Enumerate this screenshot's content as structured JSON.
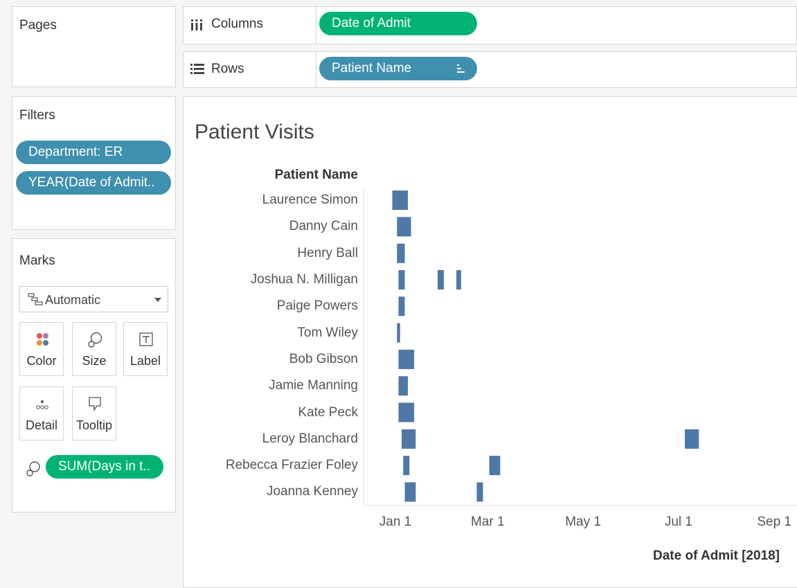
{
  "pages": {
    "title": "Pages"
  },
  "columns": {
    "label": "Columns",
    "pill": "Date of Admit"
  },
  "rows": {
    "label": "Rows",
    "pill": "Patient Name"
  },
  "filters": {
    "title": "Filters",
    "items": [
      "Department: ER",
      "YEAR(Date of Admit.."
    ]
  },
  "marks": {
    "title": "Marks",
    "mark_type": "Automatic",
    "cards": {
      "color": "Color",
      "size": "Size",
      "label": "Label",
      "detail": "Detail",
      "tooltip": "Tooltip"
    },
    "size_pill": "SUM(Days in t.."
  },
  "colors": {
    "bar": "#4e79a7",
    "green_pill": "#00b373",
    "blue_pill": "#3f8fae"
  },
  "chart_data": {
    "type": "bar",
    "title": "Patient Visits",
    "row_header": "Patient Name",
    "xlabel": "Date of Admit [2018]",
    "x_axis_type": "date",
    "x_ticks": [
      "Jan 1",
      "Mar 1",
      "May 1",
      "Jul 1",
      "Sep 1"
    ],
    "xlim": [
      "2017-12-20",
      "2018-09-10"
    ],
    "grid": false,
    "patients": [
      {
        "name": "Laurence Simon",
        "visits": [
          {
            "start": "2017-12-30",
            "end": "2018-01-09"
          }
        ]
      },
      {
        "name": "Danny Cain",
        "visits": [
          {
            "start": "2018-01-02",
            "end": "2018-01-11"
          }
        ]
      },
      {
        "name": "Henry Ball",
        "visits": [
          {
            "start": "2018-01-02",
            "end": "2018-01-07"
          }
        ]
      },
      {
        "name": "Joshua N. Milligan",
        "visits": [
          {
            "start": "2018-01-03",
            "end": "2018-01-07"
          },
          {
            "start": "2018-01-28",
            "end": "2018-02-01"
          },
          {
            "start": "2018-02-09",
            "end": "2018-02-12"
          }
        ]
      },
      {
        "name": "Paige Powers",
        "visits": [
          {
            "start": "2018-01-03",
            "end": "2018-01-07"
          }
        ]
      },
      {
        "name": "Tom Wiley",
        "visits": [
          {
            "start": "2018-01-02",
            "end": "2018-01-04"
          }
        ]
      },
      {
        "name": "Bob Gibson",
        "visits": [
          {
            "start": "2018-01-03",
            "end": "2018-01-13"
          }
        ]
      },
      {
        "name": "Jamie Manning",
        "visits": [
          {
            "start": "2018-01-03",
            "end": "2018-01-09"
          }
        ]
      },
      {
        "name": "Kate Peck",
        "visits": [
          {
            "start": "2018-01-03",
            "end": "2018-01-13"
          }
        ]
      },
      {
        "name": "Leroy Blanchard",
        "visits": [
          {
            "start": "2018-01-05",
            "end": "2018-01-14"
          },
          {
            "start": "2018-07-05",
            "end": "2018-07-14"
          }
        ]
      },
      {
        "name": "Rebecca Frazier Foley",
        "visits": [
          {
            "start": "2018-01-06",
            "end": "2018-01-10"
          },
          {
            "start": "2018-03-02",
            "end": "2018-03-09"
          }
        ]
      },
      {
        "name": "Joanna Kenney",
        "visits": [
          {
            "start": "2018-01-07",
            "end": "2018-01-14"
          },
          {
            "start": "2018-02-22",
            "end": "2018-02-26"
          }
        ]
      }
    ]
  }
}
